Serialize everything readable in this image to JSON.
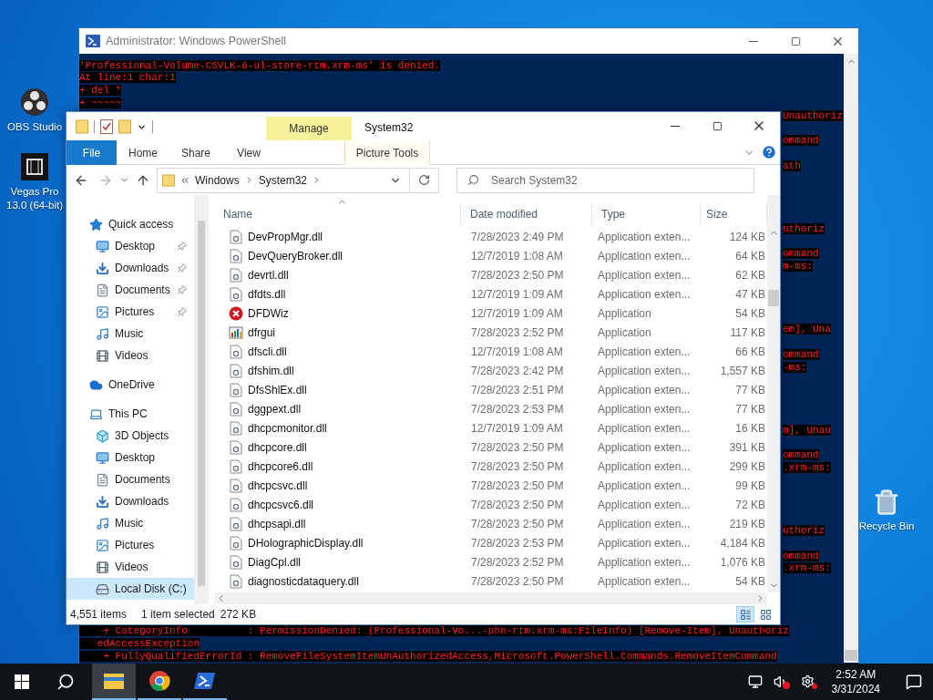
{
  "desktop": {
    "icons": [
      {
        "label": "OBS Studio",
        "kind": "obs"
      },
      {
        "label": "Vegas Pro 13.0 (64-bit)",
        "kind": "vegas"
      },
      {
        "label": "Recycle Bin",
        "kind": "recycle"
      }
    ]
  },
  "powershell": {
    "title": "Administrator: Windows PowerShell",
    "lines": [
      {
        "kind": "full",
        "text": "'Professional-Volume-CSVLK-6-ul-store-rtm.xrm-ms' is denied."
      },
      {
        "kind": "full",
        "text": "At line:1 char:1"
      },
      {
        "kind": "full",
        "text": "+ del *"
      },
      {
        "kind": "full",
        "text": "+ ~~~~~"
      },
      {
        "kind": "tail",
        "text": "Unauthoriz"
      },
      {
        "kind": "covered"
      },
      {
        "kind": "tail",
        "text": "ommand"
      },
      {
        "kind": "covered"
      },
      {
        "kind": "tail",
        "text": "ath"
      },
      {
        "kind": "covered"
      },
      {
        "kind": "covered"
      },
      {
        "kind": "covered"
      },
      {
        "kind": "covered"
      },
      {
        "kind": "tail",
        "text": "uthoriz"
      },
      {
        "kind": "covered"
      },
      {
        "kind": "tail",
        "text": "ommand"
      },
      {
        "kind": "tail",
        "text": "m-ms:"
      },
      {
        "kind": "covered"
      },
      {
        "kind": "covered"
      },
      {
        "kind": "covered"
      },
      {
        "kind": "covered"
      },
      {
        "kind": "tail",
        "text": "em], Una"
      },
      {
        "kind": "covered"
      },
      {
        "kind": "tail",
        "text": "ommand"
      },
      {
        "kind": "tail",
        "text": "-ms:"
      },
      {
        "kind": "covered"
      },
      {
        "kind": "covered"
      },
      {
        "kind": "covered"
      },
      {
        "kind": "covered"
      },
      {
        "kind": "tail",
        "text": "m], Unau"
      },
      {
        "kind": "covered"
      },
      {
        "kind": "tail",
        "text": "ommand"
      },
      {
        "kind": "tail",
        "text": ".xrm-ms:"
      },
      {
        "kind": "covered"
      },
      {
        "kind": "covered"
      },
      {
        "kind": "covered"
      },
      {
        "kind": "covered"
      },
      {
        "kind": "tail",
        "text": "uthoriz"
      },
      {
        "kind": "covered"
      },
      {
        "kind": "tail",
        "text": "ommand"
      },
      {
        "kind": "tail",
        "text": ".xrm-ms:"
      },
      {
        "kind": "covered"
      },
      {
        "kind": "covered"
      },
      {
        "kind": "covered"
      },
      {
        "kind": "covered"
      },
      {
        "kind": "full",
        "text": "    + CategoryInfo          : PermissionDenied: (Professional-Vo...-phn-rtm.xrm-ms:FileInfo) [Remove-Item], Unauthoriz"
      },
      {
        "kind": "full",
        "text": "   edAccessException"
      },
      {
        "kind": "full",
        "text": "    + FullyQualifiedErrorId : RemoveFileSystemItemUnAuthorizedAccess,Microsoft.PowerShell.Commands.RemoveItemCommand"
      }
    ]
  },
  "explorer": {
    "title": "System32",
    "context_tab": {
      "label": "Manage",
      "group": "Picture Tools"
    },
    "tabs": [
      {
        "label": "File",
        "kind": "file"
      },
      {
        "label": "Home",
        "kind": "plain"
      },
      {
        "label": "Share",
        "kind": "plain"
      },
      {
        "label": "View",
        "kind": "plain"
      }
    ],
    "breadcrumbs": [
      "Windows",
      "System32"
    ],
    "search": {
      "placeholder": "Search System32"
    },
    "sidebar": [
      {
        "label": "Quick access",
        "kind": "star",
        "selected": false,
        "children": [
          {
            "label": "Desktop",
            "kind": "desktop",
            "selected": false,
            "pinned": true
          },
          {
            "label": "Downloads",
            "kind": "downloads",
            "selected": false,
            "pinned": true
          },
          {
            "label": "Documents",
            "kind": "documents",
            "selected": false,
            "pinned": true
          },
          {
            "label": "Pictures",
            "kind": "pictures",
            "selected": false,
            "pinned": true
          },
          {
            "label": "Music",
            "kind": "music",
            "selected": false,
            "pinned": false
          },
          {
            "label": "Videos",
            "kind": "videos",
            "selected": false,
            "pinned": false
          }
        ]
      },
      {
        "label": "OneDrive",
        "kind": "cloud",
        "selected": false
      },
      {
        "label": "This PC",
        "kind": "pc",
        "selected": false,
        "children": [
          {
            "label": "3D Objects",
            "kind": "objects",
            "selected": false
          },
          {
            "label": "Desktop",
            "kind": "desktop",
            "selected": false
          },
          {
            "label": "Documents",
            "kind": "documents",
            "selected": false
          },
          {
            "label": "Downloads",
            "kind": "downloads",
            "selected": false
          },
          {
            "label": "Music",
            "kind": "music",
            "selected": false
          },
          {
            "label": "Pictures",
            "kind": "pictures",
            "selected": false
          },
          {
            "label": "Videos",
            "kind": "videos",
            "selected": false
          },
          {
            "label": "Local Disk (C:)",
            "kind": "disk",
            "selected": true
          }
        ]
      }
    ],
    "columns": [
      "Name",
      "Date modified",
      "Type",
      "Size"
    ],
    "files": [
      {
        "name": "DevPropMgr.dll",
        "date": "7/28/2023 2:49 PM",
        "type": "Application exten...",
        "size": "124 KB",
        "kind": "dll"
      },
      {
        "name": "DevQueryBroker.dll",
        "date": "12/7/2019 1:08 AM",
        "type": "Application exten...",
        "size": "64 KB",
        "kind": "dll"
      },
      {
        "name": "devrtl.dll",
        "date": "7/28/2023 2:50 PM",
        "type": "Application exten...",
        "size": "62 KB",
        "kind": "dll"
      },
      {
        "name": "dfdts.dll",
        "date": "12/7/2019 1:09 AM",
        "type": "Application exten...",
        "size": "47 KB",
        "kind": "dll"
      },
      {
        "name": "DFDWiz",
        "date": "12/7/2019 1:09 AM",
        "type": "Application",
        "size": "54 KB",
        "kind": "error-app"
      },
      {
        "name": "dfrgui",
        "date": "7/28/2023 2:52 PM",
        "type": "Application",
        "size": "117 KB",
        "kind": "app"
      },
      {
        "name": "dfscli.dll",
        "date": "12/7/2019 1:08 AM",
        "type": "Application exten...",
        "size": "66 KB",
        "kind": "dll"
      },
      {
        "name": "dfshim.dll",
        "date": "7/28/2023 2:42 PM",
        "type": "Application exten...",
        "size": "1,557 KB",
        "kind": "dll"
      },
      {
        "name": "DfsShlEx.dll",
        "date": "7/28/2023 2:51 PM",
        "type": "Application exten...",
        "size": "77 KB",
        "kind": "dll"
      },
      {
        "name": "dggpext.dll",
        "date": "7/28/2023 2:53 PM",
        "type": "Application exten...",
        "size": "77 KB",
        "kind": "dll"
      },
      {
        "name": "dhcpcmonitor.dll",
        "date": "12/7/2019 1:09 AM",
        "type": "Application exten...",
        "size": "16 KB",
        "kind": "dll"
      },
      {
        "name": "dhcpcore.dll",
        "date": "7/28/2023 2:50 PM",
        "type": "Application exten...",
        "size": "391 KB",
        "kind": "dll"
      },
      {
        "name": "dhcpcore6.dll",
        "date": "7/28/2023 2:50 PM",
        "type": "Application exten...",
        "size": "299 KB",
        "kind": "dll"
      },
      {
        "name": "dhcpcsvc.dll",
        "date": "7/28/2023 2:50 PM",
        "type": "Application exten...",
        "size": "99 KB",
        "kind": "dll"
      },
      {
        "name": "dhcpcsvc6.dll",
        "date": "7/28/2023 2:50 PM",
        "type": "Application exten...",
        "size": "72 KB",
        "kind": "dll"
      },
      {
        "name": "dhcpsapi.dll",
        "date": "7/28/2023 2:50 PM",
        "type": "Application exten...",
        "size": "219 KB",
        "kind": "dll"
      },
      {
        "name": "DHolographicDisplay.dll",
        "date": "7/28/2023 2:53 PM",
        "type": "Application exten...",
        "size": "4,184 KB",
        "kind": "dll"
      },
      {
        "name": "DiagCpl.dll",
        "date": "7/28/2023 2:52 PM",
        "type": "Application exten...",
        "size": "1,076 KB",
        "kind": "dll"
      },
      {
        "name": "diagnosticdataquery.dll",
        "date": "7/28/2023 2:50 PM",
        "type": "Application exten...",
        "size": "54 KB",
        "kind": "dll"
      }
    ],
    "status": {
      "count": "4,551 items",
      "selection": "1 item selected",
      "size": "272 KB"
    },
    "views": [
      {
        "kind": "details",
        "selected": true
      },
      {
        "kind": "large-icons",
        "selected": false
      }
    ]
  },
  "taskbar": {
    "apps": [
      {
        "kind": "explorer",
        "active": true
      },
      {
        "kind": "chrome",
        "active": false
      },
      {
        "kind": "powershell",
        "active": false
      }
    ],
    "time": "2:52 AM",
    "date": "3/31/2024"
  }
}
